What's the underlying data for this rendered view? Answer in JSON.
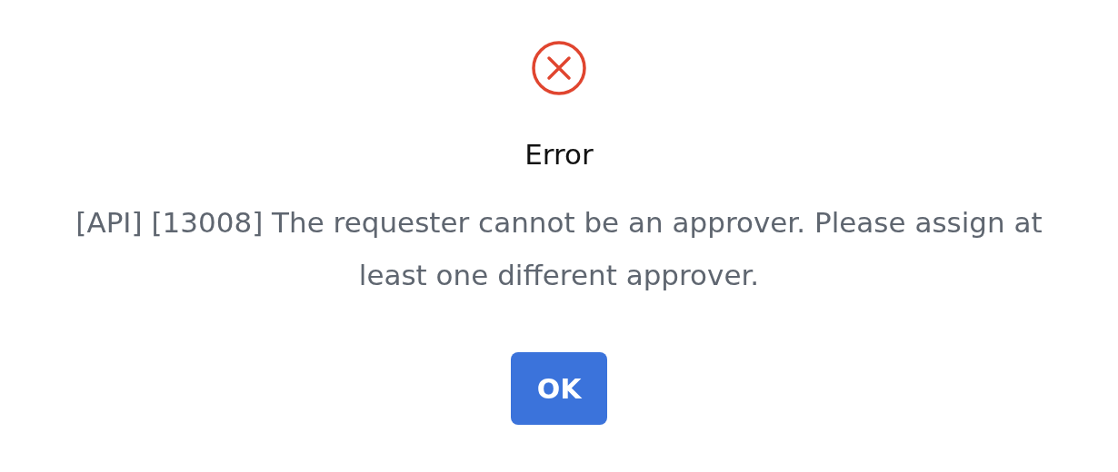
{
  "dialog": {
    "title": "Error",
    "message": "[API] [13008] The requester cannot be an approver. Please assign at least one different approver.",
    "buttons": [
      {
        "label": "OK"
      }
    ]
  }
}
